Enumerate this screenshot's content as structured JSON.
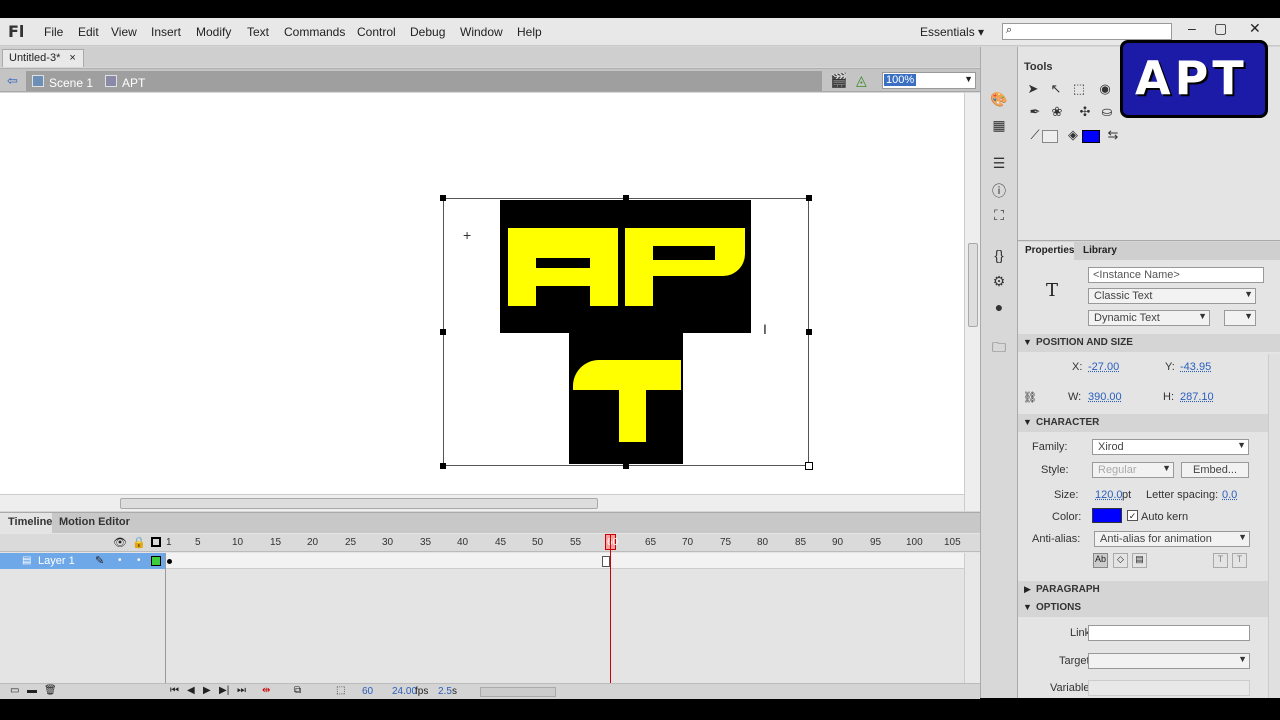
{
  "app": {
    "logo": "Fl"
  },
  "menu": [
    "File",
    "Edit",
    "View",
    "Insert",
    "Modify",
    "Text",
    "Commands",
    "Control",
    "Debug",
    "Window",
    "Help"
  ],
  "workspace": "Essentials",
  "window_buttons": [
    "–",
    "▢",
    "✕"
  ],
  "document_tab": {
    "title": "Untitled-3*",
    "close": "×"
  },
  "breadcrumb": {
    "scene": "Scene 1",
    "symbol": "APT"
  },
  "zoom": "100%",
  "stage_text": {
    "top": "AP",
    "bottom": "T"
  },
  "timeline": {
    "tabs": [
      "Timeline",
      "Motion Editor"
    ],
    "frame_numbers": [
      "1",
      "5",
      "10",
      "15",
      "20",
      "25",
      "30",
      "35",
      "40",
      "45",
      "50",
      "55",
      "60",
      "65",
      "70",
      "75",
      "80",
      "85",
      "90",
      "95",
      "100",
      "105"
    ],
    "layer_name": "Layer 1",
    "status": {
      "frame": "60",
      "fps": "24.00",
      "fps_unit": "fps",
      "time": "2.5",
      "time_unit": "s"
    }
  },
  "tools": {
    "title": "Tools"
  },
  "properties": {
    "tabs": [
      "Properties",
      "Library"
    ],
    "instance_name_placeholder": "<Instance Name>",
    "text_engine": "Classic Text",
    "text_type": "Dynamic Text",
    "position_size": {
      "header": "POSITION AND SIZE",
      "x_label": "X:",
      "x": "-27.00",
      "y_label": "Y:",
      "y": "-43.95",
      "w_label": "W:",
      "w": "390.00",
      "h_label": "H:",
      "h": "287.10"
    },
    "character": {
      "header": "CHARACTER",
      "family_label": "Family:",
      "family": "Xirod",
      "style_label": "Style:",
      "style": "Regular",
      "embed": "Embed...",
      "size_label": "Size:",
      "size": "120.0",
      "size_unit": "pt",
      "letter_spacing_label": "Letter spacing:",
      "letter_spacing": "0.0",
      "color_label": "Color:",
      "color": "#0000ff",
      "auto_kern": "Auto kern",
      "antialias_label": "Anti-alias:",
      "antialias": "Anti-alias for animation"
    },
    "paragraph_header": "PARAGRAPH",
    "options": {
      "header": "OPTIONS",
      "link_label": "Link:",
      "target_label": "Target:",
      "variable_label": "Variable:"
    }
  },
  "watermark": {
    "text": "APT"
  },
  "colors": {
    "selected_layer": "#6fa8e8",
    "playhead": "#cc0000",
    "text_fill": "#ffff00",
    "text_bg": "#000000"
  }
}
